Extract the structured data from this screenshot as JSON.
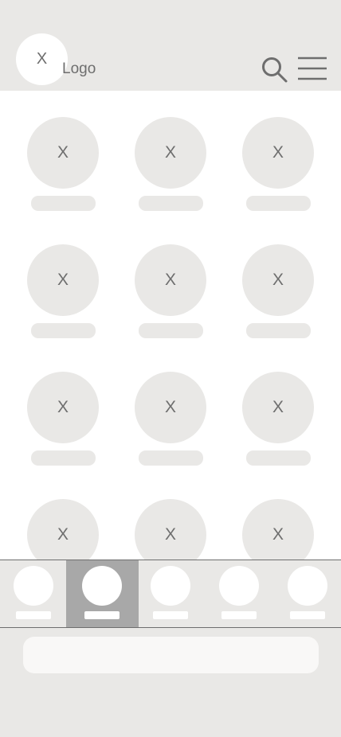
{
  "header": {
    "logo_placeholder": "X",
    "logo_text": "Logo",
    "search_icon": "search-icon",
    "menu_icon": "hamburger-menu-icon"
  },
  "grid": {
    "items": [
      {
        "placeholder": "X"
      },
      {
        "placeholder": "X"
      },
      {
        "placeholder": "X"
      },
      {
        "placeholder": "X"
      },
      {
        "placeholder": "X"
      },
      {
        "placeholder": "X"
      },
      {
        "placeholder": "X"
      },
      {
        "placeholder": "X"
      },
      {
        "placeholder": "X"
      },
      {
        "placeholder": "X"
      },
      {
        "placeholder": "X"
      },
      {
        "placeholder": "X"
      }
    ]
  },
  "tabbar": {
    "active_index": 1,
    "tab_count": 5
  },
  "colors": {
    "background": "#e9e8e6",
    "content_background": "#ffffff",
    "placeholder_text": "#6e6e6e",
    "active_tab": "#a8a8a8"
  }
}
